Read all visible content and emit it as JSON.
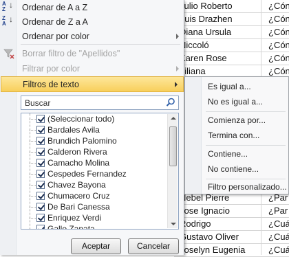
{
  "sheet": {
    "rows": [
      {
        "name": "Julio Roberto",
        "q": "¿Cón"
      },
      {
        "name": "Luis Drazhen",
        "q": "¿Cón"
      },
      {
        "name": "Diana Ursula",
        "q": "¿Cón"
      },
      {
        "name": "Niccoló",
        "q": "¿Cón"
      },
      {
        "name": "Karen Rose",
        "q": "¿Cón"
      },
      {
        "name": "Liliana",
        "q": "¿Cón"
      },
      {
        "name": "Nebel Pierre",
        "q": "¿Par"
      },
      {
        "name": "Jose Ignacio",
        "q": "¿Par"
      },
      {
        "name": "Rodrigo",
        "q": "¿Cuá"
      },
      {
        "name": "Gustavo Oliver",
        "q": "¿Cuá"
      },
      {
        "name": "Joselyn Eugenia",
        "q": "¿Cuá"
      }
    ]
  },
  "menu": {
    "sort_az": "Ordenar de A a Z",
    "sort_za": "Ordenar de Z a A",
    "sort_color": "Ordenar por color",
    "clear_filter": "Borrar filtro de \"Apellidos\"",
    "filter_color": "Filtrar por color",
    "text_filters": "Filtros de texto",
    "search_placeholder": "Buscar",
    "items": [
      "(Seleccionar todo)",
      "Bardales Avila",
      "Brundich Palomino",
      "Calderon Rivera",
      "Camacho Molina",
      "Cespedes Fernandez",
      "Chavez Bayona",
      "Chumacero Cruz",
      "De Bari Canessa",
      "Enriquez Verdi",
      "Gallo Zapata"
    ],
    "accept": "Aceptar",
    "cancel": "Cancelar"
  },
  "submenu": {
    "equals": "Es igual a...",
    "not_equals": "No es igual a...",
    "begins_with": "Comienza por...",
    "ends_with": "Termina con...",
    "contains": "Contiene...",
    "not_contains": "No contiene...",
    "custom": "Filtro personalizado..."
  }
}
